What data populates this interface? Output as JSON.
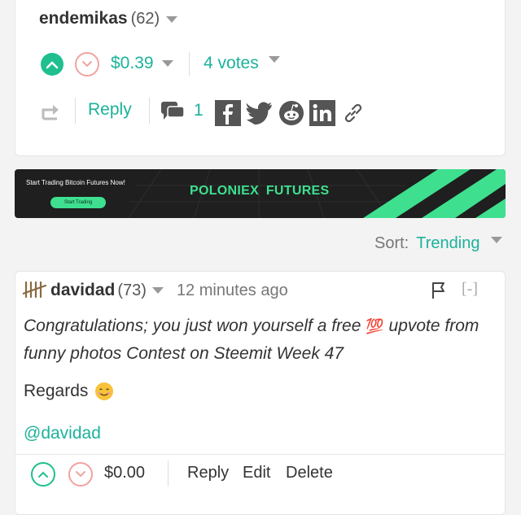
{
  "post": {
    "author": "endemikas",
    "reputation": "(62)",
    "payout": "$0.39",
    "votes": "4 votes",
    "reply_label": "Reply",
    "comment_count": "1"
  },
  "banner": {
    "tagline": "Start Trading Bitcoin Futures Now!",
    "button": "Start Trading",
    "brand": "POLONIEX",
    "brand2": "FUTURES",
    "accent": "#3ee08f"
  },
  "sort": {
    "label": "Sort:",
    "value": "Trending"
  },
  "comment": {
    "author": "davidad",
    "reputation": "(73)",
    "time": "12 minutes ago",
    "collapse": "[-]",
    "line1": "Congratulations; you just won yourself a free",
    "emoji100": "💯",
    "line1b": "upvote from",
    "line2": "funny photos Contest on Steemit Week 47",
    "regards": "Regards",
    "mention": "@davidad",
    "payout": "$0.00",
    "reply_label": "Reply",
    "edit_label": "Edit",
    "delete_label": "Delete"
  },
  "colors": {
    "green": "#1bb29b",
    "upvote": "#1fbf8f",
    "downvote": "#f1a3a0",
    "social": "#555555"
  }
}
